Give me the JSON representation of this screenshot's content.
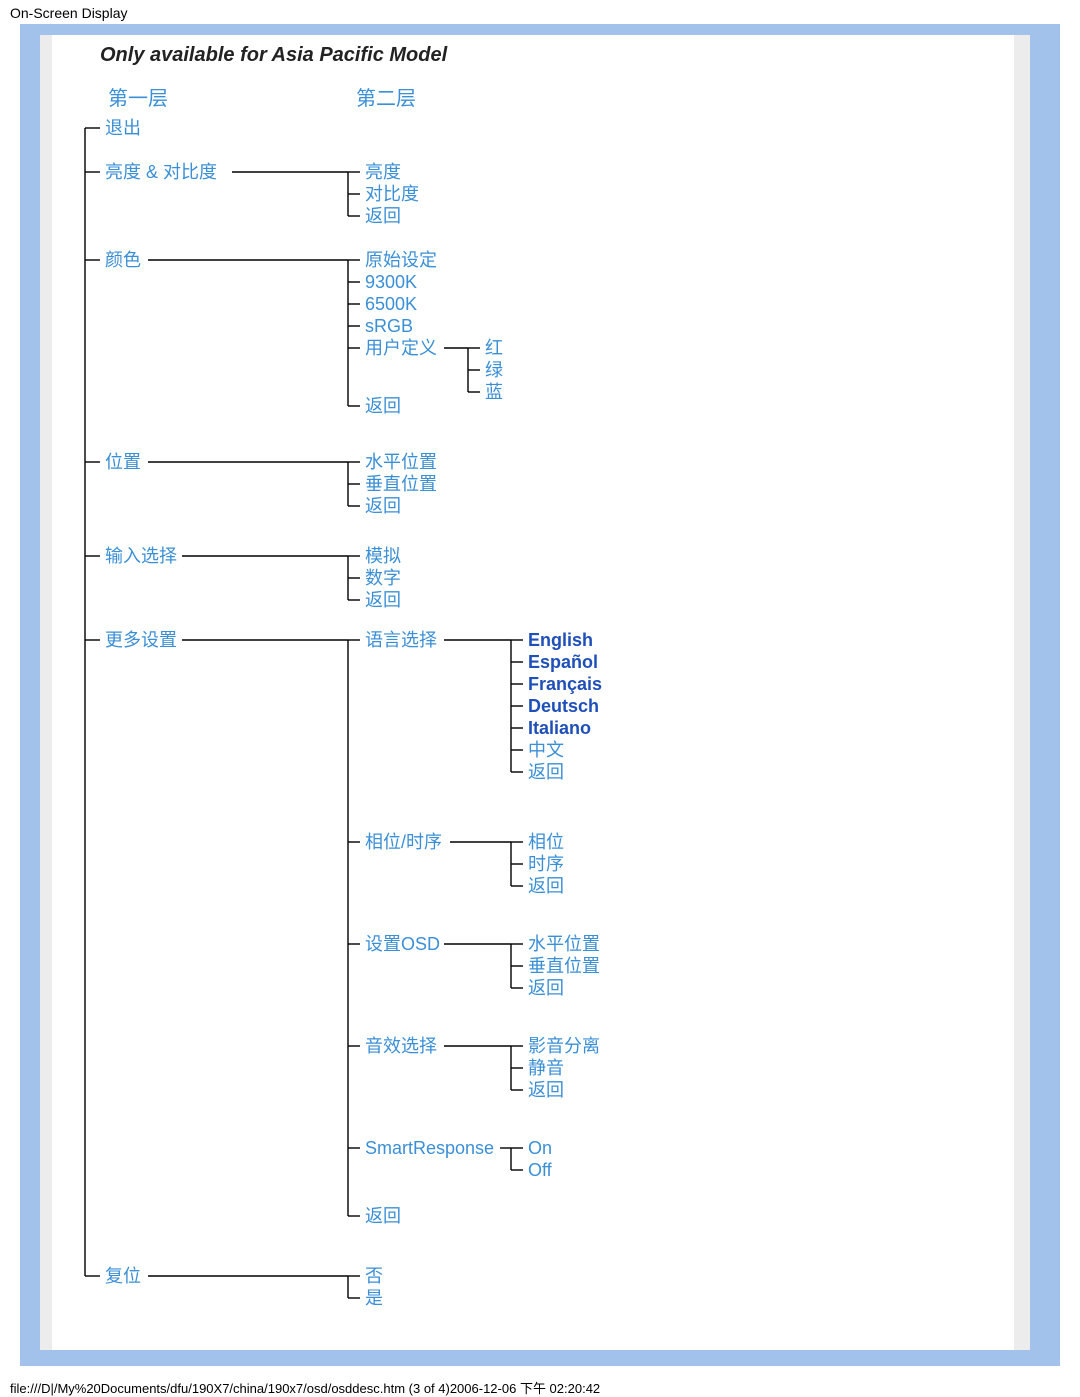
{
  "page_title": "On-Screen Display",
  "note": "Only available for Asia Pacific Model",
  "header_l1": "第一层",
  "header_l2": "第二层",
  "col1": {
    "exit": "退出",
    "bright": "亮度 & 对比度",
    "color": "颜色",
    "pos": "位置",
    "input": "输入选择",
    "more": "更多设置",
    "reset": "复位"
  },
  "col2": {
    "brightness": "亮度",
    "contrast": "对比度",
    "return1": "返回",
    "orig": "原始设定",
    "k93": "9300K",
    "k65": "6500K",
    "srgb": "sRGB",
    "user": "用户定义",
    "return2": "返回",
    "hpos": "水平位置",
    "vpos": "垂直位置",
    "return3": "返回",
    "analog": "模拟",
    "digital": "数字",
    "return4": "返回",
    "lang": "语言选择",
    "phase": "相位/时序",
    "osd": "设置OSD",
    "audio": "音效选择",
    "smart": "SmartResponse",
    "return5": "返回",
    "no": "否",
    "yes": "是"
  },
  "col3": {
    "r": "红",
    "g": "绿",
    "b": "蓝",
    "en": "English",
    "es": "Español",
    "fr": "Français",
    "de": "Deutsch",
    "it": "Italiano",
    "cn": "中文",
    "return_lang": "返回",
    "ph": "相位",
    "clk": "时序",
    "return_ph": "返回",
    "hpos": "水平位置",
    "vpos": "垂直位置",
    "return_osd": "返回",
    "sep": "影音分离",
    "mute": "静音",
    "return_au": "返回",
    "on": "On",
    "off": "Off"
  },
  "footer": "file:///D|/My%20Documents/dfu/190X7/china/190x7/osd/osddesc.htm (3 of 4)2006-12-06 下午 02:20:42"
}
